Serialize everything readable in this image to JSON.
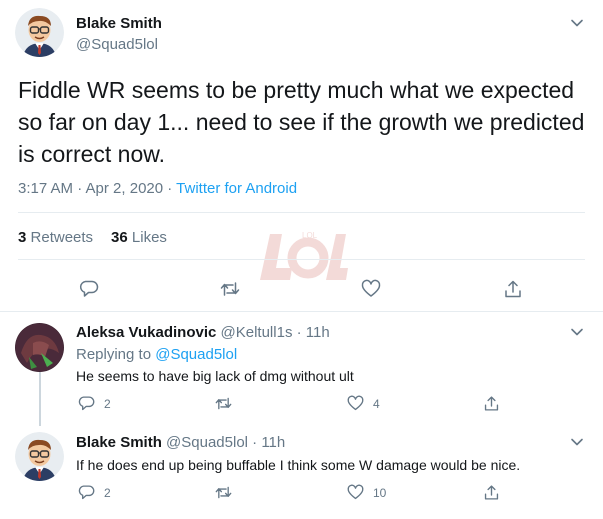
{
  "main_tweet": {
    "author_name": "Blake Smith",
    "author_handle": "@Squad5lol",
    "text": "Fiddle WR seems to be pretty much what we expected so far on day 1... need to see if the growth we predicted is correct now.",
    "time": "3:17 AM · Apr 2, 2020 · ",
    "source": "Twitter for Android",
    "retweets_count": "3",
    "retweets_label": "Retweets",
    "likes_count": "36",
    "likes_label": "Likes",
    "watermark": "LOL"
  },
  "replies": [
    {
      "author_name": "Aleksa Vukadinovic",
      "author_handle": "@Keltull1s · 11h",
      "replying_prefix": "Replying to ",
      "replying_to": "@Squad5lol",
      "text": "He seems to have big lack of dmg without ult",
      "reply_count": "2",
      "like_count": "4"
    },
    {
      "author_name": "Blake Smith",
      "author_handle": "@Squad5lol · 11h",
      "text": "If he does end up being buffable I think some W damage would be nice.",
      "reply_count": "2",
      "like_count": "10"
    }
  ],
  "colors": {
    "accent": "#1da1f2",
    "muted": "#657786",
    "divider": "#e6ecf0"
  },
  "icons": {
    "menu": "chevron-down-icon",
    "reply": "reply-icon",
    "retweet": "retweet-icon",
    "like": "heart-icon",
    "share": "share-icon"
  }
}
